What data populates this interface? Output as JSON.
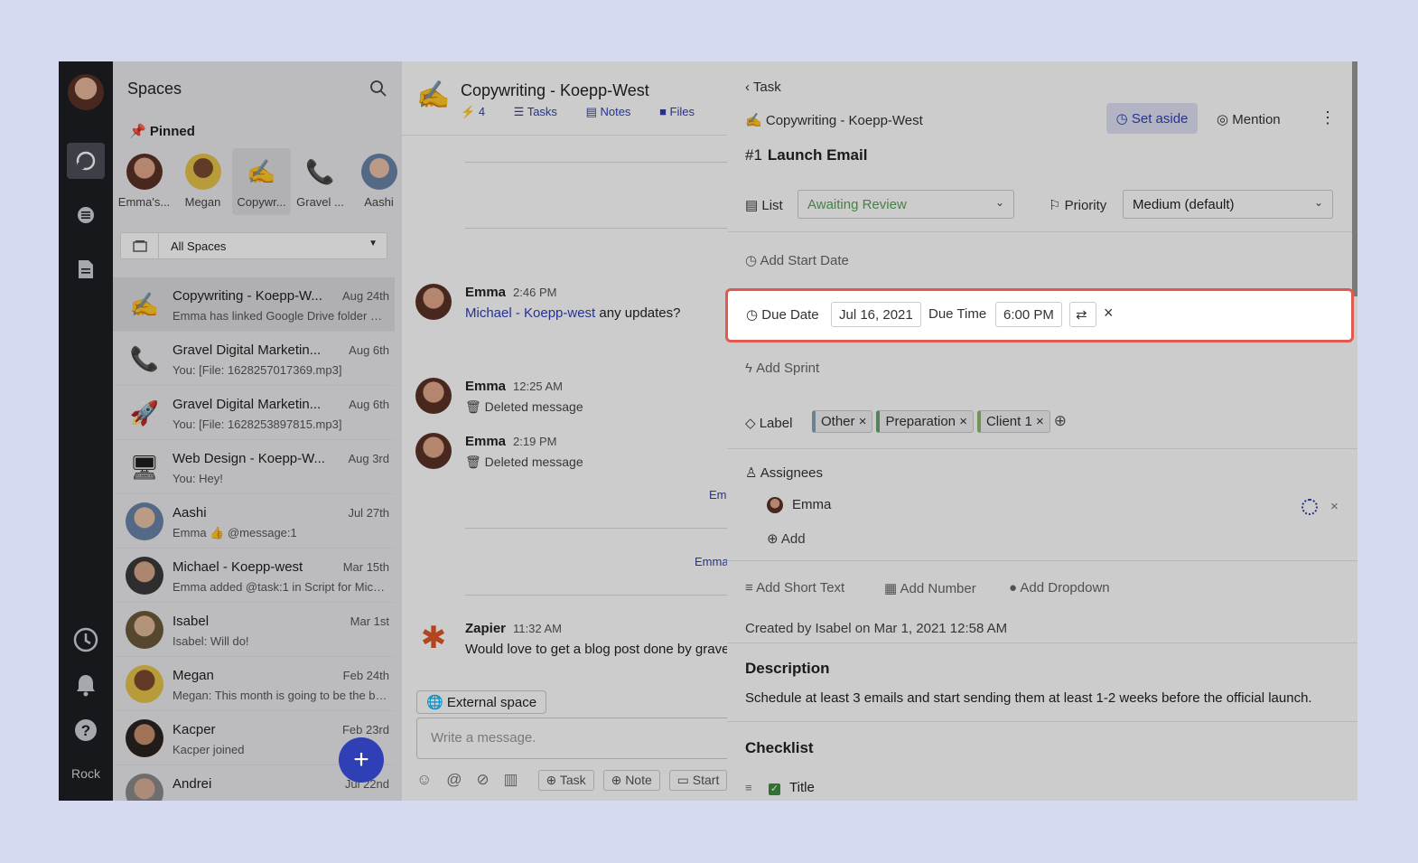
{
  "rail": {
    "brand": "Rock"
  },
  "sidebar": {
    "title": "Spaces",
    "pinned_label": "Pinned",
    "pinned": [
      {
        "label": "Emma's..."
      },
      {
        "label": "Megan"
      },
      {
        "label": "Copywr..."
      },
      {
        "label": "Gravel ..."
      },
      {
        "label": "Aashi"
      }
    ],
    "filter": "All Spaces",
    "conversations": [
      {
        "name": "Copywriting - Koepp-W...",
        "date": "Aug 24th",
        "preview": "Emma has linked Google Drive folder Co...",
        "icon": "✍"
      },
      {
        "name": "Gravel Digital Marketin...",
        "date": "Aug 6th",
        "preview": "You: [File: 1628257017369.mp3]",
        "icon": "📞"
      },
      {
        "name": "Gravel Digital Marketin...",
        "date": "Aug 6th",
        "preview": "You: [File: 1628253897815.mp3]",
        "icon": "🚀"
      },
      {
        "name": "Web Design - Koepp-W...",
        "date": "Aug 3rd",
        "preview": "You: Hey!",
        "icon": "🖥"
      },
      {
        "name": "Aashi",
        "date": "Jul 27th",
        "preview": "Emma 👍 @message:1",
        "icon": ""
      },
      {
        "name": "Michael - Koepp-west",
        "date": "Mar 15th",
        "preview": "Emma added @task:1 in Script for Mich...",
        "icon": ""
      },
      {
        "name": "Isabel",
        "date": "Mar 1st",
        "preview": "Isabel: Will do!",
        "icon": ""
      },
      {
        "name": "Megan",
        "date": "Feb 24th",
        "preview": "Megan: This month is going to be the be...",
        "icon": ""
      },
      {
        "name": "Kacper",
        "date": "Feb 23rd",
        "preview": "Kacper joined",
        "icon": ""
      },
      {
        "name": "Andrei",
        "date": "Jul 22nd",
        "preview": "",
        "icon": ""
      }
    ]
  },
  "chat": {
    "title": "Copywriting - Koepp-West",
    "count": "4",
    "tabs": {
      "tasks": "Tasks",
      "notes": "Notes",
      "files": "Files"
    },
    "messages": [
      {
        "author": "Emma",
        "time": "2:46 PM",
        "mention": "Michael - Koepp-west",
        "text": "any updates?"
      },
      {
        "author": "Emma",
        "time": "12:25 AM",
        "text": "Deleted message"
      },
      {
        "author": "Emma",
        "time": "2:19 PM",
        "text": "Deleted message"
      },
      {
        "author": "Zapier",
        "time": "11:32 AM",
        "text": "Would love to get a blog post done by grave"
      }
    ],
    "side_link_1": "Em",
    "side_link_2": "Emma",
    "external": "External space",
    "compose_placeholder": "Write a message.",
    "tools": {
      "task": "Task",
      "note": "Note",
      "start": "Start"
    }
  },
  "task": {
    "back_label": "Task",
    "space": "Copywriting - Koepp-West",
    "set_aside": "Set aside",
    "mention": "Mention",
    "number": "#1",
    "title": "Launch Email",
    "list_label": "List",
    "list_value": "Awaiting Review",
    "priority_label": "Priority",
    "priority_value": "Medium (default)",
    "start_date": "Add Start Date",
    "due_date_label": "Due Date",
    "due_date": "Jul 16, 2021",
    "due_time_label": "Due Time",
    "due_time": "6:00 PM",
    "sprint": "Add Sprint",
    "label_label": "Label",
    "labels": [
      "Other",
      "Preparation",
      "Client 1"
    ],
    "label_colors": [
      "#8aa0b8",
      "#6aa56a",
      "#8fb86a"
    ],
    "assignees_label": "Assignees",
    "assignee": "Emma",
    "add": "Add",
    "short_text": "Add Short Text",
    "number_field": "Add Number",
    "dropdown": "Add Dropdown",
    "created": "Created by Isabel on Mar 1, 2021 12:58 AM",
    "description_label": "Description",
    "description": "Schedule at least 3 emails and start sending them at least 1-2 weeks before the official launch.",
    "checklist_label": "Checklist",
    "checklist_item": "Title"
  },
  "colors": {
    "accent": "#2f3fb5",
    "highlight": "#e05a4f",
    "list_green": "#5aa05a"
  }
}
